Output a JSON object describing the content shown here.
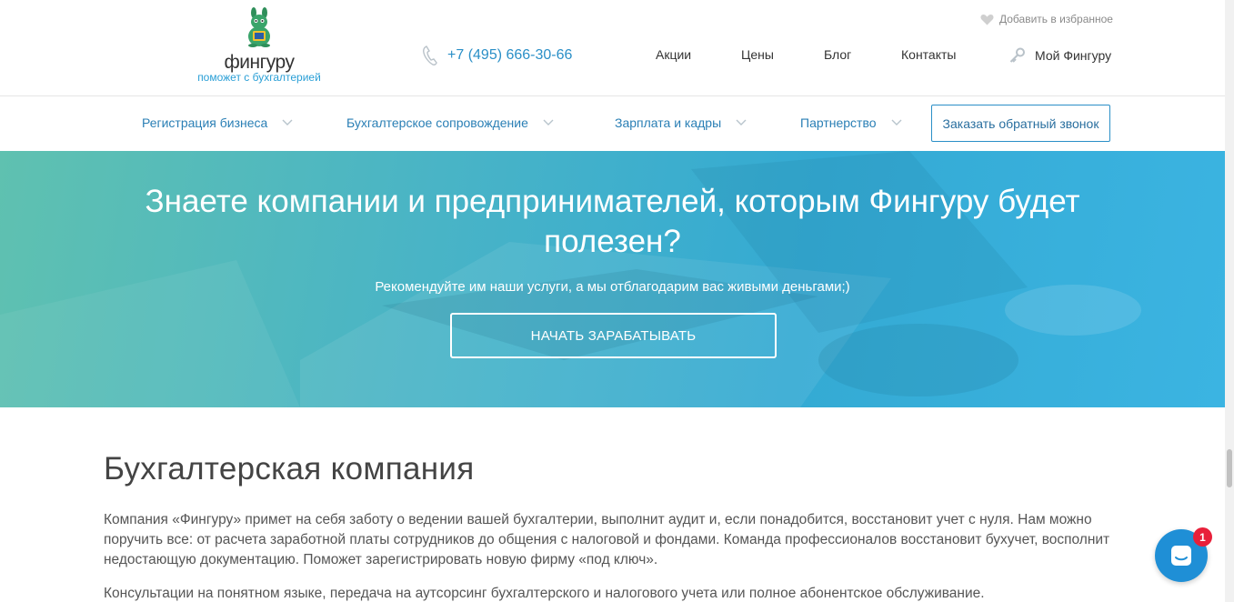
{
  "header": {
    "brand": "фингуру",
    "tagline": "поможет с бухгалтерией",
    "phone": "+7 (495) 666-30-66",
    "favorites": "Добавить в избранное",
    "nav": [
      "Акции",
      "Цены",
      "Блог",
      "Контакты"
    ],
    "account": "Мой Фингуру"
  },
  "subnav": {
    "items": [
      "Регистрация бизнеса",
      "Бухгалтерское сопровождение",
      "Зарплата и кадры",
      "Партнерство"
    ],
    "callback": "Заказать обратный звонок"
  },
  "hero": {
    "title": "Знаете компании и предпринимателей, которым Фингуру будет полезен?",
    "subtitle": "Рекомендуйте им наши услуги, а мы отблагодарим вас живыми деньгами;)",
    "cta": "НАЧАТЬ ЗАРАБАТЫВАТЬ"
  },
  "content": {
    "heading": "Бухгалтерская компания",
    "paragraph1": "Компания «Фингуру» примет на себя заботу о ведении вашей бухгалтерии, выполнит аудит и, если понадобится, восстановит учет с нуля. Нам можно поручить все: от расчета заработной платы сотрудников до общения с налоговой и фондами. Команда профессионалов восстановит бухучет, восполнит недостающую документацию. Поможет зарегистрировать новую фирму «под ключ».",
    "paragraph2": "Консультации на понятном языке, передача на аутсорсинг бухгалтерского и налогового учета или полное абонентское обслуживание."
  },
  "chat": {
    "badge": "1"
  },
  "colors": {
    "accent": "#2a8fc7",
    "hero_start": "#5fc1b0",
    "hero_end": "#3bb4e2",
    "badge": "#e8203a"
  },
  "icons": {
    "logo": "kangaroo-mascot-icon",
    "phone": "phone-handset-icon",
    "favorites": "heart-icon",
    "account": "key-icon",
    "dropdown": "chevron-down-icon",
    "chat": "chat-bubble-icon"
  }
}
